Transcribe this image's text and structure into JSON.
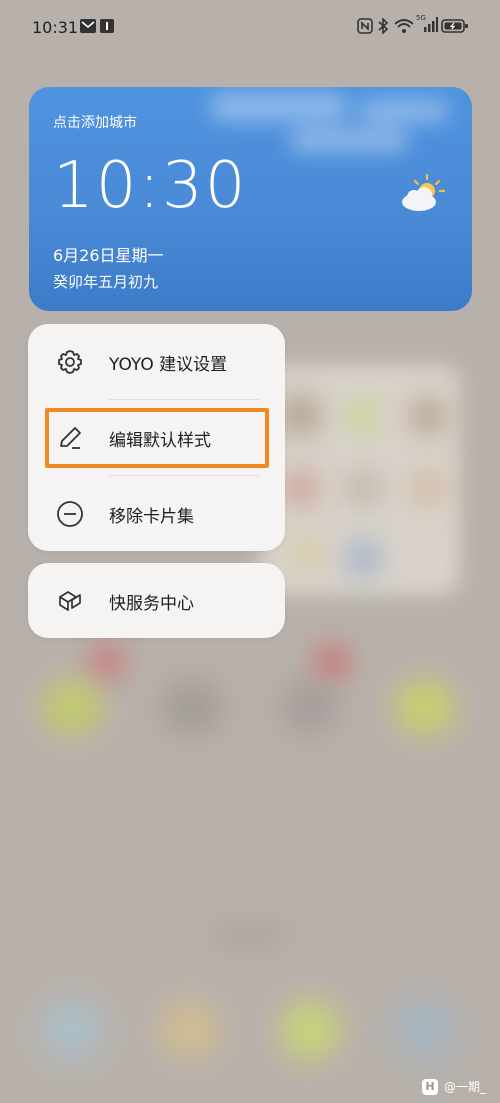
{
  "status_bar": {
    "time": "10:31",
    "network_label": "5G"
  },
  "weather_widget": {
    "add_city": "点击添加城市",
    "clock": "10:30",
    "date": "6月26日星期一",
    "lunar_date": "癸卯年五月初九",
    "icon": "partly-cloudy-icon"
  },
  "menu": {
    "items": [
      {
        "label": "YOYO 建议设置",
        "icon": "gear-icon"
      },
      {
        "label": "编辑默认样式",
        "icon": "pencil-icon"
      },
      {
        "label": "移除卡片集",
        "icon": "minus-circle-icon"
      }
    ]
  },
  "service_menu": {
    "label": "快服务中心",
    "icon": "cubes-icon"
  },
  "highlight_color": "#f08a24",
  "watermark": {
    "text": "@一期_"
  }
}
